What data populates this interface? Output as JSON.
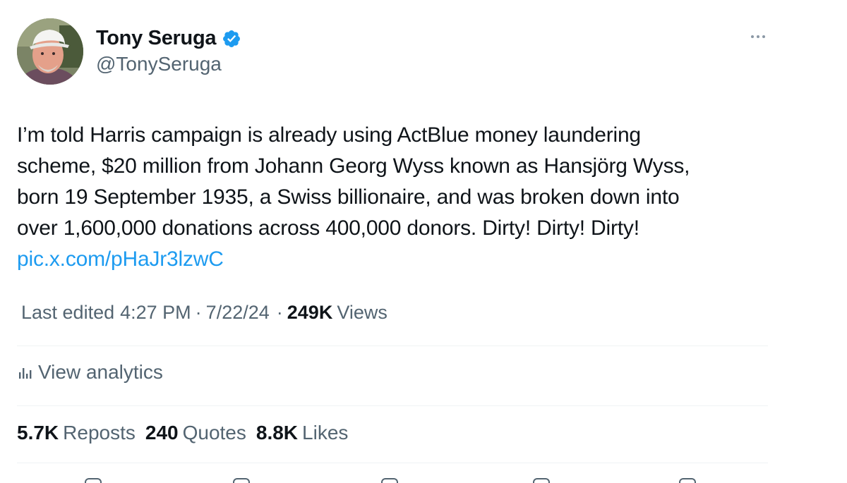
{
  "author": {
    "display_name": "Tony Seruga",
    "handle": "@TonySeruga",
    "verified": true,
    "verified_color": "#1d9bf0"
  },
  "tweet": {
    "lines": [
      "I’m told Harris campaign is already using ActBlue money laundering",
      "scheme, $20 million from Johann Georg Wyss known as Hansjörg Wyss,",
      "born 19 September 1935, a Swiss billionaire, and was broken down into",
      "over 1,600,000 donations across 400,000 donors. Dirty! Dirty! Dirty!"
    ],
    "link": "pic.x.com/pHaJr3lzwC",
    "link_color": "#1d9bf0"
  },
  "meta": {
    "edited_label": "Last edited",
    "time": "4:27 PM",
    "separator": "·",
    "date": "7/22/24",
    "views_count": "249K",
    "views_label": "Views"
  },
  "analytics": {
    "icon": "bar-chart-icon",
    "label": "View analytics"
  },
  "stats": [
    {
      "count": "5.7K",
      "label": "Reposts"
    },
    {
      "count": "240",
      "label": "Quotes"
    },
    {
      "count": "8.8K",
      "label": "Likes"
    }
  ],
  "actions": [
    {
      "icon": "reply-icon"
    },
    {
      "icon": "repost-icon"
    },
    {
      "icon": "like-icon"
    },
    {
      "icon": "bookmark-icon"
    },
    {
      "icon": "share-icon"
    }
  ],
  "colors": {
    "text_primary": "#0f1419",
    "text_secondary": "#536471",
    "divider": "#eff3f4"
  }
}
